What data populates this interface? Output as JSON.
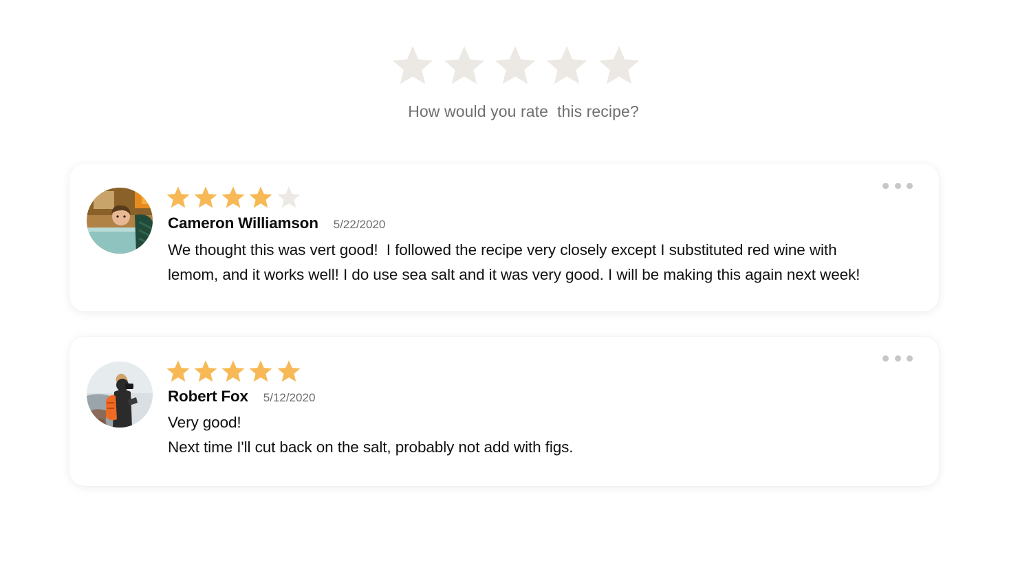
{
  "rating_prompt": {
    "question": "How would you rate  this recipe?",
    "max_stars": 5,
    "selected": 0,
    "empty_star_color": "#ece9e4"
  },
  "colors": {
    "star_filled": "#f7b955",
    "star_empty": "#ece9e4",
    "menu_dots": "#c7c7c7"
  },
  "reviews": [
    {
      "rating": 4,
      "max_rating": 5,
      "name": "Cameron Williamson",
      "date": "5/22/2020",
      "text_lines": [
        "We thought this was vert good!  I followed the recipe very closely except I substituted red wine with",
        "lemom, and it works well! I do use sea salt and it was very good. I will be making this again next week!"
      ],
      "avatar_icon": "child-photo-avatar",
      "menu_icon": "more-dots-icon"
    },
    {
      "rating": 5,
      "max_rating": 5,
      "name": "Robert Fox",
      "date": "5/12/2020",
      "text_lines": [
        "Very good!",
        "Next time I'll cut back on the salt, probably not add with figs."
      ],
      "avatar_icon": "photographer-photo-avatar",
      "menu_icon": "more-dots-icon"
    }
  ]
}
